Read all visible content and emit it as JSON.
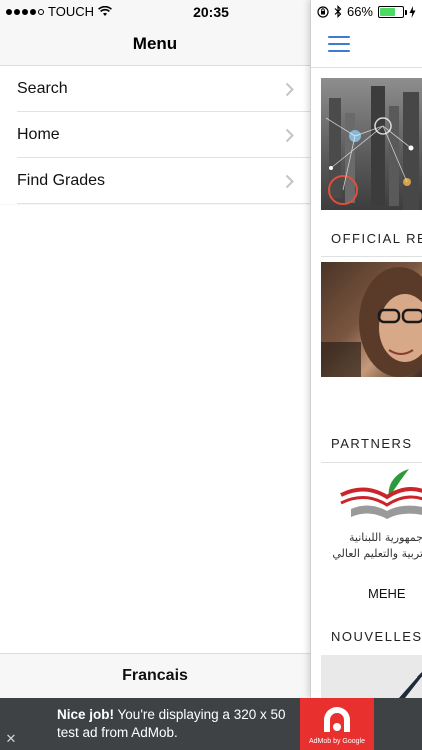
{
  "status_bar": {
    "carrier": "TOUCH",
    "time": "20:35",
    "battery": "66%",
    "battery_level": 0.66
  },
  "menu": {
    "title": "Menu",
    "items": [
      {
        "label": "Search",
        "icon": "chevron-right-icon"
      },
      {
        "label": "Home",
        "icon": "chevron-right-icon"
      },
      {
        "label": "Find Grades",
        "icon": "chevron-right-icon"
      }
    ],
    "footer_label": "Francais"
  },
  "content": {
    "sections": [
      {
        "label": "OFFICIAL RE"
      },
      {
        "label": "PARTNERS"
      },
      {
        "label": "NOUVELLES"
      }
    ],
    "logo_arabic_line1": "جمهورية اللبنانية",
    "logo_arabic_line2": "تربية والتعليم العالي",
    "partner_name": "MEHE"
  },
  "ad": {
    "headline": "Nice job!",
    "body": "You're displaying a 320 x 50 test ad from AdMob.",
    "logo_caption": "AdMob by Google",
    "accent": "#e8312f"
  },
  "colors": {
    "hamburger": "#3b7bd6",
    "ad_background": "#3f4245",
    "battery": "#4cd964"
  }
}
